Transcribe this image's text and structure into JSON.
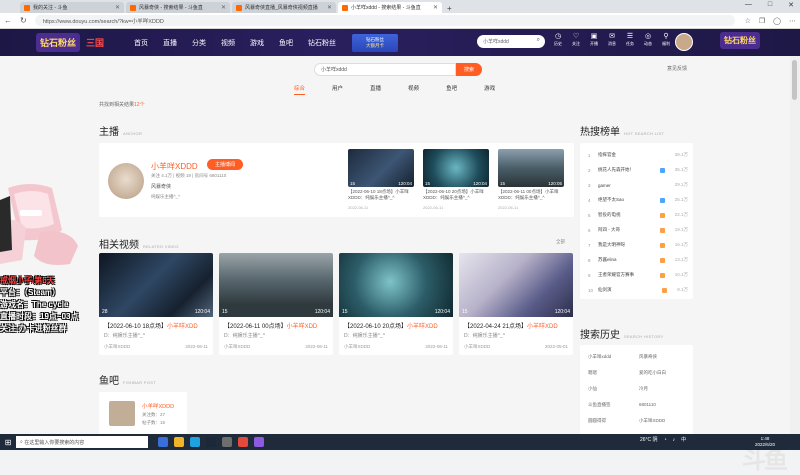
{
  "browser": {
    "tabs": [
      {
        "label": "我的关注 - 斗鱼",
        "active": false
      },
      {
        "label": "风暴奇侠 - 搜索结果 - 斗鱼直",
        "active": false
      },
      {
        "label": "风暴奇侠直播_风暴奇侠视频直播",
        "active": false
      },
      {
        "label": "小羊咩xddd - 搜索结果 - 斗鱼直",
        "active": true
      }
    ],
    "new_tab": "+",
    "window_controls": [
      "—",
      "□",
      "✕"
    ],
    "url": "https://www.douyu.com/search/?kw=小羊咩XDDD"
  },
  "header": {
    "logo_badge": "钻石粉丝",
    "brand": "三国",
    "nav": [
      "首页",
      "直播",
      "分类",
      "视频",
      "游戏",
      "鱼吧",
      "钻石粉丝"
    ],
    "vip_line1": "钻石粉丝",
    "vip_line2": "大额月卡",
    "search_value": "小羊咩xddd",
    "icons": [
      {
        "label": "历史",
        "glyph": "◷"
      },
      {
        "label": "关注",
        "glyph": "♡"
      },
      {
        "label": "开播",
        "glyph": "▣"
      },
      {
        "label": "消息",
        "glyph": "✉"
      },
      {
        "label": "任务",
        "glyph": "☰"
      },
      {
        "label": "动态",
        "glyph": "◎"
      },
      {
        "label": "福利",
        "glyph": "⚲"
      }
    ],
    "right_badge": "钻石粉丝"
  },
  "search": {
    "value": "小羊咩xddd",
    "button": "搜索",
    "feedback": "意见反馈",
    "tabs": [
      "综合",
      "用户",
      "直播",
      "视频",
      "鱼吧",
      "游戏"
    ],
    "found_prefix": "共找到相关结果",
    "found_count": "12个"
  },
  "anchor_section": {
    "title": "主播",
    "subtitle": "ANCHOR",
    "name": "小羊咩XDDD",
    "follow": "主播博闻",
    "stats": "关注 4.1万 | 视频 19 | 房间号 6801110",
    "category": "风暴奇侠",
    "desc": "纯娱乐主播^_^",
    "mini_videos": [
      {
        "caption": "【2022-06-10 18点场】小羊咩XDDD：纯娱乐主播^_^",
        "date": "2022-06-11",
        "duration": "120:04",
        "plays": "15"
      },
      {
        "caption": "【2022-06-10 20点场】小羊咩XDDD：纯娱乐主播^_^",
        "date": "2022-06-11",
        "duration": "120:04",
        "plays": "15"
      },
      {
        "caption": "【2022-06-11 00点场】小羊咩XDDD：纯娱乐主播^_^",
        "date": "2022-06-11",
        "duration": "120:05",
        "plays": "15"
      }
    ]
  },
  "videos_section": {
    "title": "相关视频",
    "subtitle": "RELATED VIDEO",
    "all": "全部",
    "videos": [
      {
        "prefix": "【2022-06-10 18点场】",
        "name": "小羊咩XDD",
        "desc": "D：纯娱乐主播^_^",
        "author": "小羊咩XDDD",
        "date": "2022-06-11",
        "duration": "120:04",
        "plays": "28"
      },
      {
        "prefix": "【2022-06-11 00点场】",
        "name": "小羊咩XDD",
        "desc": "D：纯娱乐主播^_^",
        "author": "小羊咩XDDD",
        "date": "2022-06-11",
        "duration": "120:04",
        "plays": "15"
      },
      {
        "prefix": "【2022-06-10 20点场】",
        "name": "小羊咩XDD",
        "desc": "D：纯娱乐主播^_^",
        "author": "小羊咩XDDD",
        "date": "2022-06-11",
        "duration": "120:04",
        "plays": "15"
      },
      {
        "prefix": "【2022-04-24 21点场】",
        "name": "小羊咩XDD",
        "desc": "D：纯娱乐主播^_^",
        "author": "小羊咩XDDD",
        "date": "2022-05-01",
        "duration": "120:04",
        "plays": "15"
      }
    ]
  },
  "fish_section": {
    "title": "鱼吧",
    "subtitle": "FISHBAR POST",
    "name": "小羊咩XDDD",
    "members": "关注数：27",
    "posts": "帖子数：15"
  },
  "hot_section": {
    "title": "热搜榜单",
    "subtitle": "HOT SEARCH LIST",
    "items": [
      {
        "rank": "1",
        "name": "指挥官金",
        "tag": "",
        "score": "38.1万"
      },
      {
        "rank": "2",
        "name": "桃花人先森开始！",
        "tag": "#4ea5ff",
        "score": "35.1万"
      },
      {
        "rank": "3",
        "name": "gamer",
        "tag": "",
        "score": "29.1万"
      },
      {
        "rank": "4",
        "name": "绝望不太Sao",
        "tag": "#4ea5ff",
        "score": "25.1万"
      },
      {
        "rank": "5",
        "name": "智投的电视",
        "tag": "#ff9f43",
        "score": "22.1万"
      },
      {
        "rank": "6",
        "name": "阿四 - 大哥",
        "tag": "#ff9f43",
        "score": "19.1万"
      },
      {
        "rank": "7",
        "name": "我是大明神呀",
        "tag": "#ff9f43",
        "score": "16.1万"
      },
      {
        "rank": "8",
        "name": "苏酱elina",
        "tag": "#ff9f43",
        "score": "13.1万"
      },
      {
        "rank": "9",
        "name": "王者荣耀官方赛事",
        "tag": "#ff9f43",
        "score": "10.1万"
      },
      {
        "rank": "10",
        "name": "仙剑演",
        "tag": "#ff9f43",
        "score": "8.1万"
      }
    ]
  },
  "history_section": {
    "title": "搜索历史",
    "subtitle": "SEARCH HISTORY",
    "items": [
      "小羊咩xddd",
      "风暴奇侠",
      "嗯嗯",
      "爱的吃小白白",
      "小仙",
      "冷月",
      "斗鱼直播签",
      "6801110",
      "圆圆得得",
      "小羊咩XDDD"
    ]
  },
  "overlay": {
    "lines": [
      "戒烟小子/第6天",
      "平台：（Steam）",
      "游戏名：The cycle",
      "直播时段：19点~03点",
      "关注-办卡进粉丝群"
    ]
  },
  "taskbar": {
    "search_placeholder": "在这里输入你要搜索的内容",
    "weather": "26°C 阴",
    "ime": "中",
    "time": "1:48",
    "date": "2022/6/20"
  },
  "watermark": "斗鱼",
  "colors": {
    "accent": "#ff5d23",
    "header_bg": "#1c1745",
    "taskbar_bg": "#1f2b3a"
  }
}
